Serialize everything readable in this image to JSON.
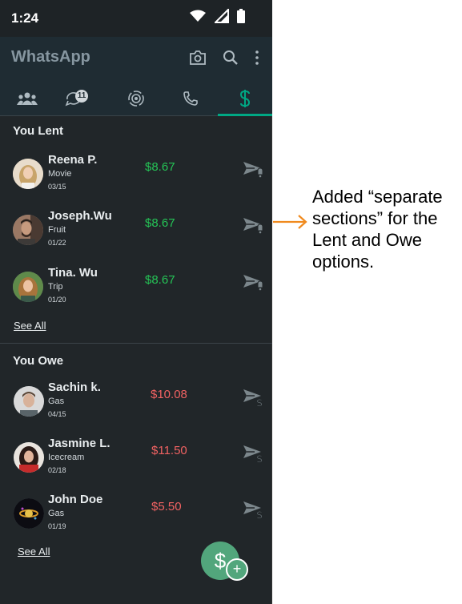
{
  "status": {
    "time": "1:24"
  },
  "appbar": {
    "title": "WhatsApp"
  },
  "tabs": {
    "chats_badge": "11"
  },
  "lent": {
    "title": "You Lent",
    "see_all": "See All",
    "rows": [
      {
        "name": "Reena P.",
        "memo": "Movie",
        "date": "03/15",
        "amount": "$8.67"
      },
      {
        "name": "Joseph.Wu",
        "memo": "Fruit",
        "date": "01/22",
        "amount": "$8.67"
      },
      {
        "name": "Tina. Wu",
        "memo": "Trip",
        "date": "01/20",
        "amount": "$8.67"
      }
    ]
  },
  "owe": {
    "title": "You Owe",
    "see_all": "See All",
    "rows": [
      {
        "name": "Sachin k.",
        "memo": "Gas",
        "date": "04/15",
        "amount": "$10.08"
      },
      {
        "name": "Jasmine L.",
        "memo": "Icecream",
        "date": "02/18",
        "amount": "$11.50"
      },
      {
        "name": "John Doe",
        "memo": "Gas",
        "date": "01/19",
        "amount": "$5.50"
      }
    ]
  },
  "fab": {
    "symbol": "$",
    "plus": "+"
  },
  "annotation": {
    "text": "Added “separate sections” for the Lent and Owe options."
  },
  "colors": {
    "accent": "#00a884",
    "lent": "#25c456",
    "owe": "#f06262",
    "annotation_arrow": "#f08a1e"
  }
}
